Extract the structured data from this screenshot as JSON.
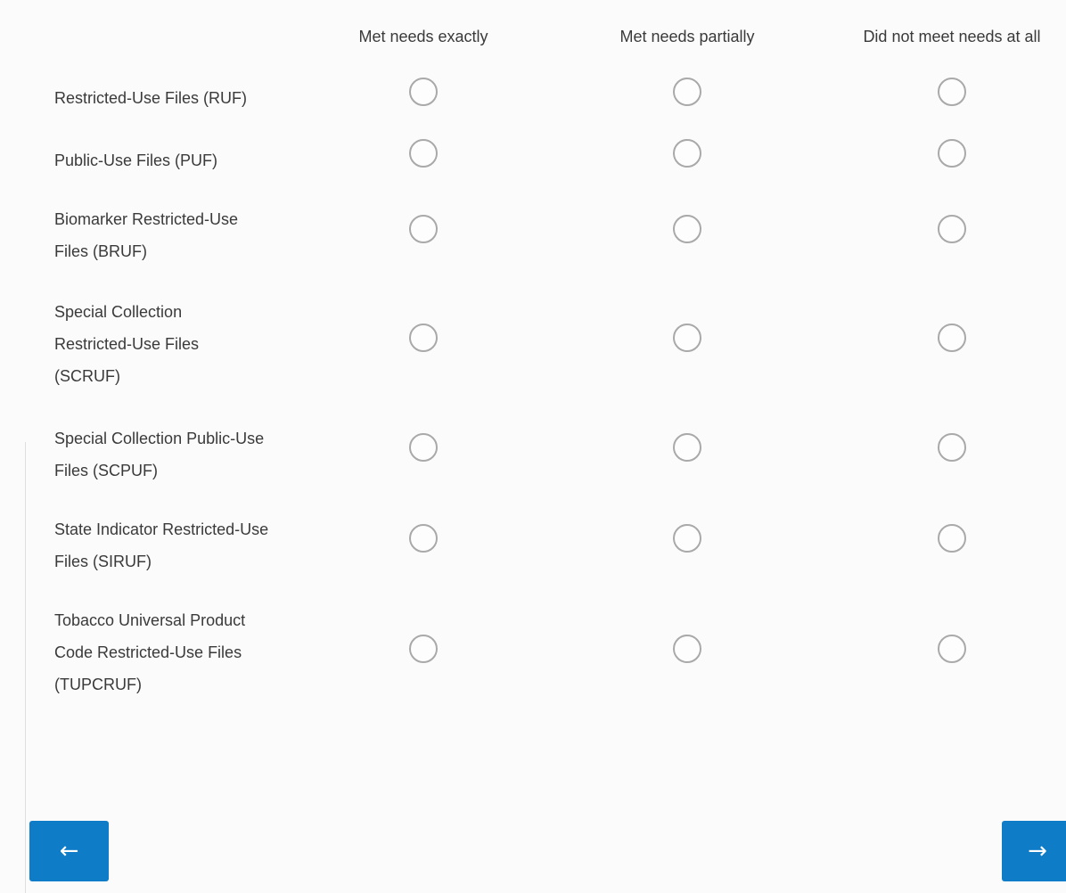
{
  "columns": [
    {
      "label": "Met needs exactly"
    },
    {
      "label": "Met needs partially"
    },
    {
      "label": "Did not meet needs at all"
    }
  ],
  "rows": [
    {
      "label": "Restricted-Use Files (RUF)"
    },
    {
      "label": "Public-Use Files (PUF)"
    },
    {
      "label": "Biomarker Restricted-Use Files (BRUF)"
    },
    {
      "label": "Special Collection Restricted-Use Files (SCRUF)"
    },
    {
      "label": "Special Collection Public-Use Files (SCPUF)"
    },
    {
      "label": "State Indicator Restricted-Use Files (SIRUF)"
    },
    {
      "label": "Tobacco Universal Product Code Restricted-Use Files (TUPCRUF)"
    }
  ],
  "navigation": {
    "prev_icon": "arrow-left-icon",
    "prev_glyph": "←",
    "next_icon": "arrow-right-icon",
    "next_glyph": "→"
  },
  "colors": {
    "nav_button": "#0f7cc7",
    "radio_border": "#a9a9a9",
    "background": "#fbfbfb",
    "text": "#3a3a3a"
  }
}
